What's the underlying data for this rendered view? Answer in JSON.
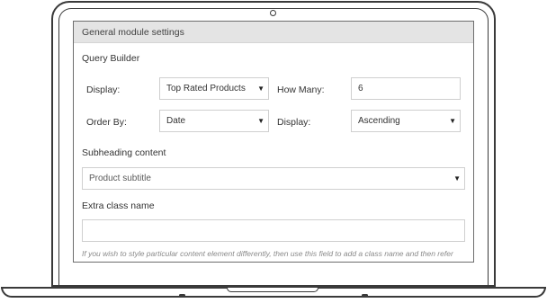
{
  "panel": {
    "title": "General module settings"
  },
  "query_builder": {
    "title": "Query Builder",
    "display_label": "Display:",
    "display_value": "Top Rated Products",
    "how_many_label": "How Many:",
    "how_many_value": "6",
    "order_by_label": "Order By:",
    "order_by_value": "Date",
    "order_display_label": "Display:",
    "order_display_value": "Ascending"
  },
  "subheading": {
    "title": "Subheading content",
    "value": "Product subtitle"
  },
  "extra_class": {
    "title": "Extra class name",
    "value": "",
    "help": "If you wish to style particular content element differently, then use this field to add a class name and then refer"
  },
  "icons": {
    "dropdown": "chevron-down-icon",
    "camera": "camera-icon"
  }
}
